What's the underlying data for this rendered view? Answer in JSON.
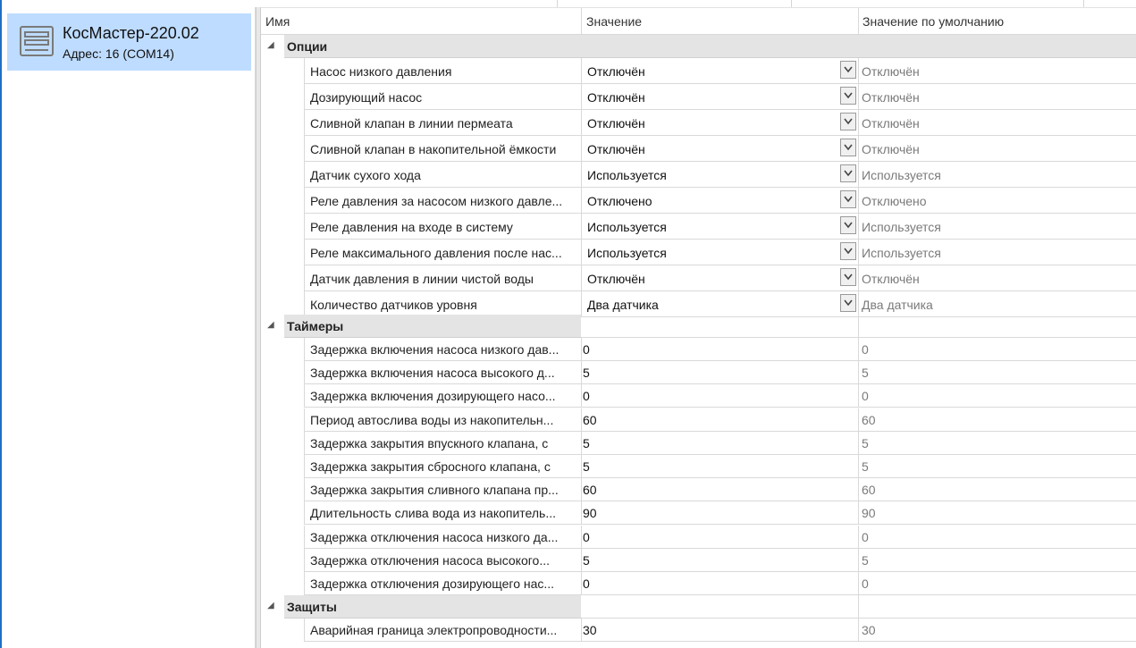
{
  "device": {
    "name": "КосМастер-220.02",
    "address": "Адрес: 16 (COM14)"
  },
  "grid": {
    "col_name": "Имя",
    "col_value": "Значение",
    "col_default": "Значение по умолчанию"
  },
  "categories": [
    {
      "title": "Опции",
      "rows": [
        {
          "name": "Насос низкого давления",
          "value": "Отключён",
          "default": "Отключён"
        },
        {
          "name": "Дозирующий насос",
          "value": "Отключён",
          "default": "Отключён"
        },
        {
          "name": "Сливной клапан в линии пермеата",
          "value": "Отключён",
          "default": "Отключён"
        },
        {
          "name": "Сливной клапан в накопительной ёмкости",
          "value": "Отключён",
          "default": "Отключён"
        },
        {
          "name": "Датчик сухого хода",
          "value": "Используется",
          "default": "Используется"
        },
        {
          "name": "Реле давления за насосом низкого давле...",
          "value": "Отключено",
          "default": "Отключено"
        },
        {
          "name": "Реле давления на входе в систему",
          "value": "Используется",
          "default": "Используется"
        },
        {
          "name": "Реле максимального давления после нас...",
          "value": "Используется",
          "default": "Используется"
        },
        {
          "name": "Датчик давления в линии чистой воды",
          "value": "Отключён",
          "default": "Отключён"
        },
        {
          "name": "Количество датчиков уровня",
          "value": "Два датчика",
          "default": "Два датчика"
        }
      ]
    },
    {
      "title": "Таймеры",
      "rows": [
        {
          "name": "Задержка включения насоса низкого дав...",
          "value": "0",
          "default": "0"
        },
        {
          "name": "Задержка включения насоса высокого д...",
          "value": "5",
          "default": "5"
        },
        {
          "name": "Задержка включения дозирующего насо...",
          "value": "0",
          "default": "0"
        },
        {
          "name": "Период автослива воды из накопительн...",
          "value": "60",
          "default": "60"
        },
        {
          "name": "Задержка закрытия впускного клапана, с",
          "value": "5",
          "default": "5"
        },
        {
          "name": "Задержка закрытия сбросного клапана, с",
          "value": "5",
          "default": "5"
        },
        {
          "name": "Задержка закрытия сливного клапана пр...",
          "value": "60",
          "default": "60"
        },
        {
          "name": "Длительность слива вода из накопитель...",
          "value": "90",
          "default": "90"
        },
        {
          "name": "Задержка отключения насоса низкого да...",
          "value": "0",
          "default": "0"
        },
        {
          "name": "Задержка отключения насоса высокого...",
          "value": "5",
          "default": "5"
        },
        {
          "name": "Задержка отключения дозирующего нас...",
          "value": "0",
          "default": "0"
        }
      ]
    },
    {
      "title": "Защиты",
      "rows": [
        {
          "name": "Аварийная граница электропроводности...",
          "value": "30",
          "default": "30"
        }
      ]
    }
  ]
}
